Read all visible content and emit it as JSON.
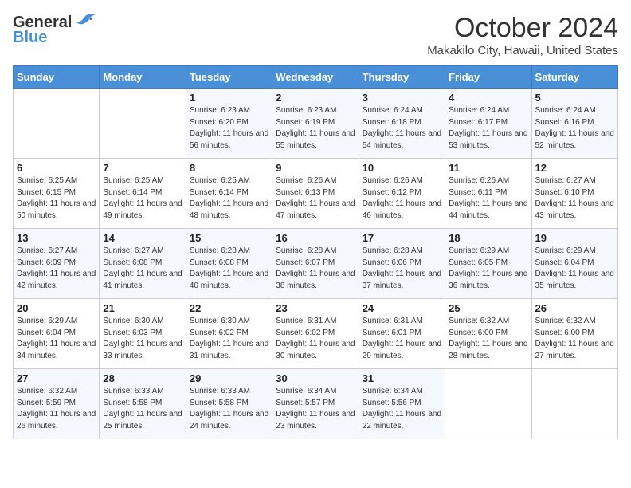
{
  "header": {
    "logo": {
      "general": "General",
      "blue": "Blue"
    },
    "month": "October 2024",
    "location": "Makakilo City, Hawaii, United States"
  },
  "weekdays": [
    "Sunday",
    "Monday",
    "Tuesday",
    "Wednesday",
    "Thursday",
    "Friday",
    "Saturday"
  ],
  "weeks": [
    [
      {
        "day": "",
        "sunrise": "",
        "sunset": "",
        "daylight": ""
      },
      {
        "day": "",
        "sunrise": "",
        "sunset": "",
        "daylight": ""
      },
      {
        "day": "1",
        "sunrise": "Sunrise: 6:23 AM",
        "sunset": "Sunset: 6:20 PM",
        "daylight": "Daylight: 11 hours and 56 minutes."
      },
      {
        "day": "2",
        "sunrise": "Sunrise: 6:23 AM",
        "sunset": "Sunset: 6:19 PM",
        "daylight": "Daylight: 11 hours and 55 minutes."
      },
      {
        "day": "3",
        "sunrise": "Sunrise: 6:24 AM",
        "sunset": "Sunset: 6:18 PM",
        "daylight": "Daylight: 11 hours and 54 minutes."
      },
      {
        "day": "4",
        "sunrise": "Sunrise: 6:24 AM",
        "sunset": "Sunset: 6:17 PM",
        "daylight": "Daylight: 11 hours and 53 minutes."
      },
      {
        "day": "5",
        "sunrise": "Sunrise: 6:24 AM",
        "sunset": "Sunset: 6:16 PM",
        "daylight": "Daylight: 11 hours and 52 minutes."
      }
    ],
    [
      {
        "day": "6",
        "sunrise": "Sunrise: 6:25 AM",
        "sunset": "Sunset: 6:15 PM",
        "daylight": "Daylight: 11 hours and 50 minutes."
      },
      {
        "day": "7",
        "sunrise": "Sunrise: 6:25 AM",
        "sunset": "Sunset: 6:14 PM",
        "daylight": "Daylight: 11 hours and 49 minutes."
      },
      {
        "day": "8",
        "sunrise": "Sunrise: 6:25 AM",
        "sunset": "Sunset: 6:14 PM",
        "daylight": "Daylight: 11 hours and 48 minutes."
      },
      {
        "day": "9",
        "sunrise": "Sunrise: 6:26 AM",
        "sunset": "Sunset: 6:13 PM",
        "daylight": "Daylight: 11 hours and 47 minutes."
      },
      {
        "day": "10",
        "sunrise": "Sunrise: 6:26 AM",
        "sunset": "Sunset: 6:12 PM",
        "daylight": "Daylight: 11 hours and 46 minutes."
      },
      {
        "day": "11",
        "sunrise": "Sunrise: 6:26 AM",
        "sunset": "Sunset: 6:11 PM",
        "daylight": "Daylight: 11 hours and 44 minutes."
      },
      {
        "day": "12",
        "sunrise": "Sunrise: 6:27 AM",
        "sunset": "Sunset: 6:10 PM",
        "daylight": "Daylight: 11 hours and 43 minutes."
      }
    ],
    [
      {
        "day": "13",
        "sunrise": "Sunrise: 6:27 AM",
        "sunset": "Sunset: 6:09 PM",
        "daylight": "Daylight: 11 hours and 42 minutes."
      },
      {
        "day": "14",
        "sunrise": "Sunrise: 6:27 AM",
        "sunset": "Sunset: 6:08 PM",
        "daylight": "Daylight: 11 hours and 41 minutes."
      },
      {
        "day": "15",
        "sunrise": "Sunrise: 6:28 AM",
        "sunset": "Sunset: 6:08 PM",
        "daylight": "Daylight: 11 hours and 40 minutes."
      },
      {
        "day": "16",
        "sunrise": "Sunrise: 6:28 AM",
        "sunset": "Sunset: 6:07 PM",
        "daylight": "Daylight: 11 hours and 38 minutes."
      },
      {
        "day": "17",
        "sunrise": "Sunrise: 6:28 AM",
        "sunset": "Sunset: 6:06 PM",
        "daylight": "Daylight: 11 hours and 37 minutes."
      },
      {
        "day": "18",
        "sunrise": "Sunrise: 6:29 AM",
        "sunset": "Sunset: 6:05 PM",
        "daylight": "Daylight: 11 hours and 36 minutes."
      },
      {
        "day": "19",
        "sunrise": "Sunrise: 6:29 AM",
        "sunset": "Sunset: 6:04 PM",
        "daylight": "Daylight: 11 hours and 35 minutes."
      }
    ],
    [
      {
        "day": "20",
        "sunrise": "Sunrise: 6:29 AM",
        "sunset": "Sunset: 6:04 PM",
        "daylight": "Daylight: 11 hours and 34 minutes."
      },
      {
        "day": "21",
        "sunrise": "Sunrise: 6:30 AM",
        "sunset": "Sunset: 6:03 PM",
        "daylight": "Daylight: 11 hours and 33 minutes."
      },
      {
        "day": "22",
        "sunrise": "Sunrise: 6:30 AM",
        "sunset": "Sunset: 6:02 PM",
        "daylight": "Daylight: 11 hours and 31 minutes."
      },
      {
        "day": "23",
        "sunrise": "Sunrise: 6:31 AM",
        "sunset": "Sunset: 6:02 PM",
        "daylight": "Daylight: 11 hours and 30 minutes."
      },
      {
        "day": "24",
        "sunrise": "Sunrise: 6:31 AM",
        "sunset": "Sunset: 6:01 PM",
        "daylight": "Daylight: 11 hours and 29 minutes."
      },
      {
        "day": "25",
        "sunrise": "Sunrise: 6:32 AM",
        "sunset": "Sunset: 6:00 PM",
        "daylight": "Daylight: 11 hours and 28 minutes."
      },
      {
        "day": "26",
        "sunrise": "Sunrise: 6:32 AM",
        "sunset": "Sunset: 6:00 PM",
        "daylight": "Daylight: 11 hours and 27 minutes."
      }
    ],
    [
      {
        "day": "27",
        "sunrise": "Sunrise: 6:32 AM",
        "sunset": "Sunset: 5:59 PM",
        "daylight": "Daylight: 11 hours and 26 minutes."
      },
      {
        "day": "28",
        "sunrise": "Sunrise: 6:33 AM",
        "sunset": "Sunset: 5:58 PM",
        "daylight": "Daylight: 11 hours and 25 minutes."
      },
      {
        "day": "29",
        "sunrise": "Sunrise: 6:33 AM",
        "sunset": "Sunset: 5:58 PM",
        "daylight": "Daylight: 11 hours and 24 minutes."
      },
      {
        "day": "30",
        "sunrise": "Sunrise: 6:34 AM",
        "sunset": "Sunset: 5:57 PM",
        "daylight": "Daylight: 11 hours and 23 minutes."
      },
      {
        "day": "31",
        "sunrise": "Sunrise: 6:34 AM",
        "sunset": "Sunset: 5:56 PM",
        "daylight": "Daylight: 11 hours and 22 minutes."
      },
      {
        "day": "",
        "sunrise": "",
        "sunset": "",
        "daylight": ""
      },
      {
        "day": "",
        "sunrise": "",
        "sunset": "",
        "daylight": ""
      }
    ]
  ]
}
